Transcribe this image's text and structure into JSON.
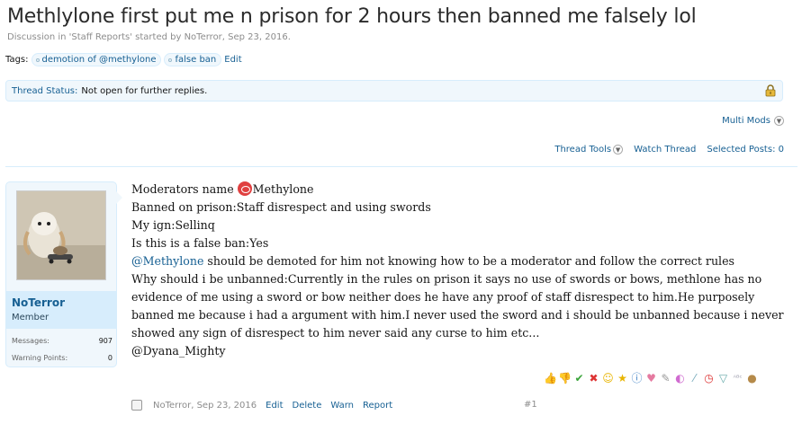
{
  "thread": {
    "title": "Methlylone first put me n prison for 2 hours then banned me falsely lol",
    "meta_prefix": "Discussion in '",
    "forum": "Staff Reports",
    "meta_mid": "' started by ",
    "author": "NoTerror",
    "meta_date": ", Sep 23, 2016."
  },
  "tags": {
    "label": "Tags:",
    "items": [
      "demotion of @methylone",
      "false ban"
    ],
    "edit": "Edit"
  },
  "status": {
    "label": "Thread Status:",
    "value": "Not open for further replies."
  },
  "toolbar": {
    "multi_mods": "Multi Mods",
    "thread_tools": "Thread Tools",
    "watch_thread": "Watch Thread",
    "selected_posts": "Selected Posts:",
    "selected_count": "0"
  },
  "user": {
    "name": "NoTerror",
    "title": "Member",
    "messages_label": "Messages:",
    "messages_value": "907",
    "warning_label": "Warning Points:",
    "warning_value": "0"
  },
  "post": {
    "line1_a": "Moderators name ",
    "line1_b": "Methylone",
    "line2": "Banned on prison:Staff disrespect and using swords",
    "line3": "My ign:Sellinq",
    "line4": "Is this is a false ban:Yes",
    "line5_mention": "@Methylone",
    "line5_rest": " should be demoted for him not knowing how to be a moderator and follow the correct rules",
    "para": "Why should i be unbanned:Currently in the rules on prison it says no use of swords or bows, methlone has no evidence of me using a sword or bow neither does he have any proof of staff disrespect to him.He purposely banned me because i had a argument with him.I never used the sword and i should be unbanned because i never showed any sign of disrespect to him never said any curse to him etc...",
    "line_last": "@Dyana_Mighty"
  },
  "ratings": {
    "icons": [
      "like-icon",
      "dislike-icon",
      "agree-icon",
      "disagree-icon",
      "funny-icon",
      "winner-icon",
      "informative-icon",
      "friendly-icon",
      "useful-icon",
      "creative-icon",
      "optimistic-icon",
      "late-icon",
      "dumb-icon",
      "bad-spelling-icon",
      "cookie-icon"
    ]
  },
  "footer": {
    "author": "NoTerror",
    "date": ", Sep 23, 2016",
    "edit": "Edit",
    "delete": "Delete",
    "warn": "Warn",
    "report": "Report",
    "post_number": "#1"
  }
}
